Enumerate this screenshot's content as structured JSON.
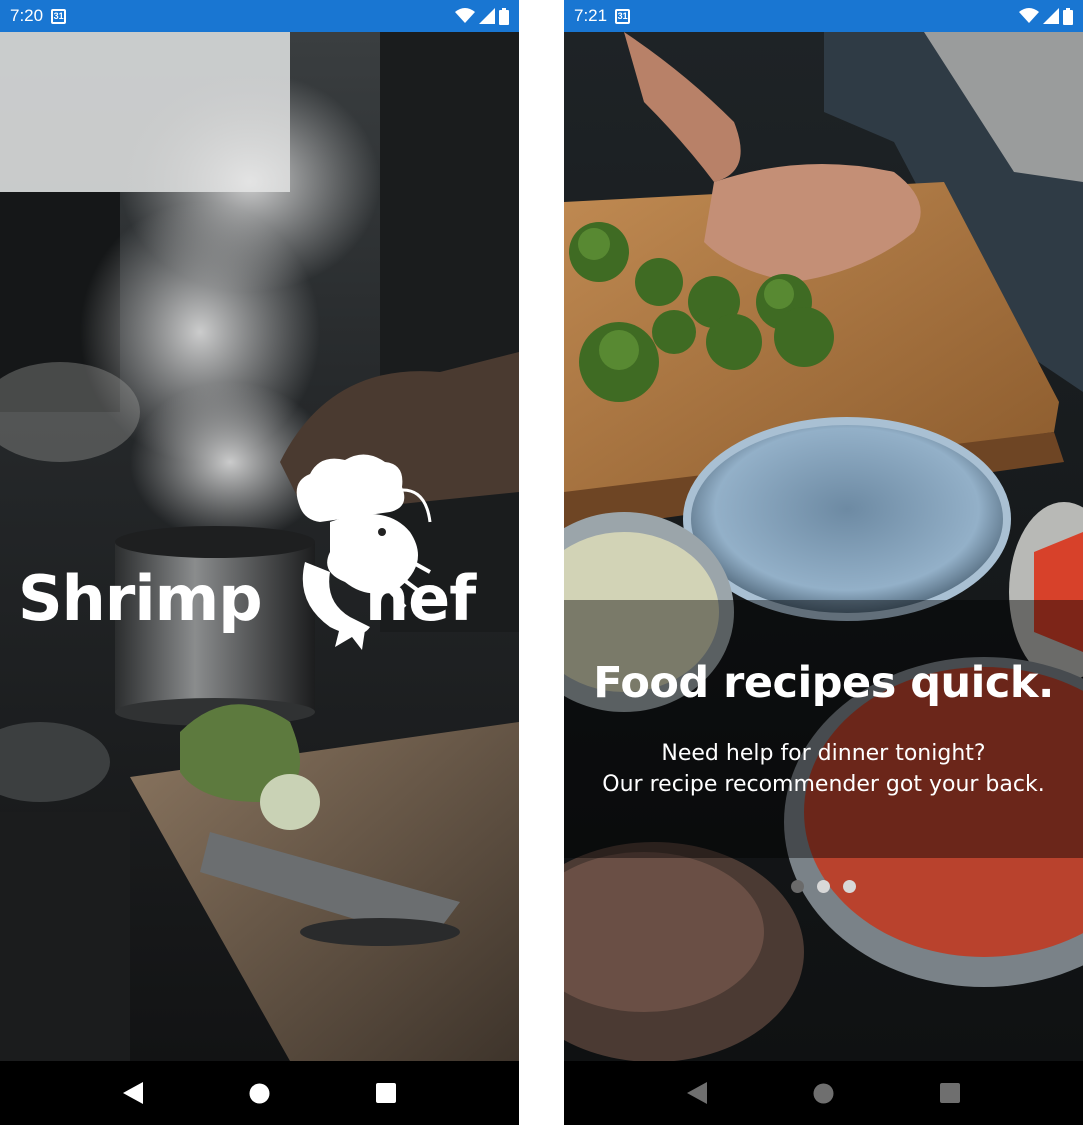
{
  "left_screen": {
    "status": {
      "time": "7:20",
      "calendar_day": "31"
    },
    "logo": {
      "word_left": "Shrimp",
      "word_right": "hef"
    }
  },
  "right_screen": {
    "status": {
      "time": "7:21",
      "calendar_day": "31"
    },
    "headline": "Food recipes quick.",
    "subtext_line1": "Need help for dinner tonight?",
    "subtext_line2": "Our recipe recommender got your back.",
    "page_indicator": {
      "total": 3,
      "active_index": 1
    }
  },
  "colors": {
    "status_bar": "#1976d2",
    "nav_bar": "#000000"
  },
  "icons": [
    "calendar-icon",
    "wifi-icon",
    "signal-icon",
    "battery-icon",
    "back-icon",
    "home-icon",
    "recents-icon",
    "shrimp-chef-logo-icon"
  ]
}
